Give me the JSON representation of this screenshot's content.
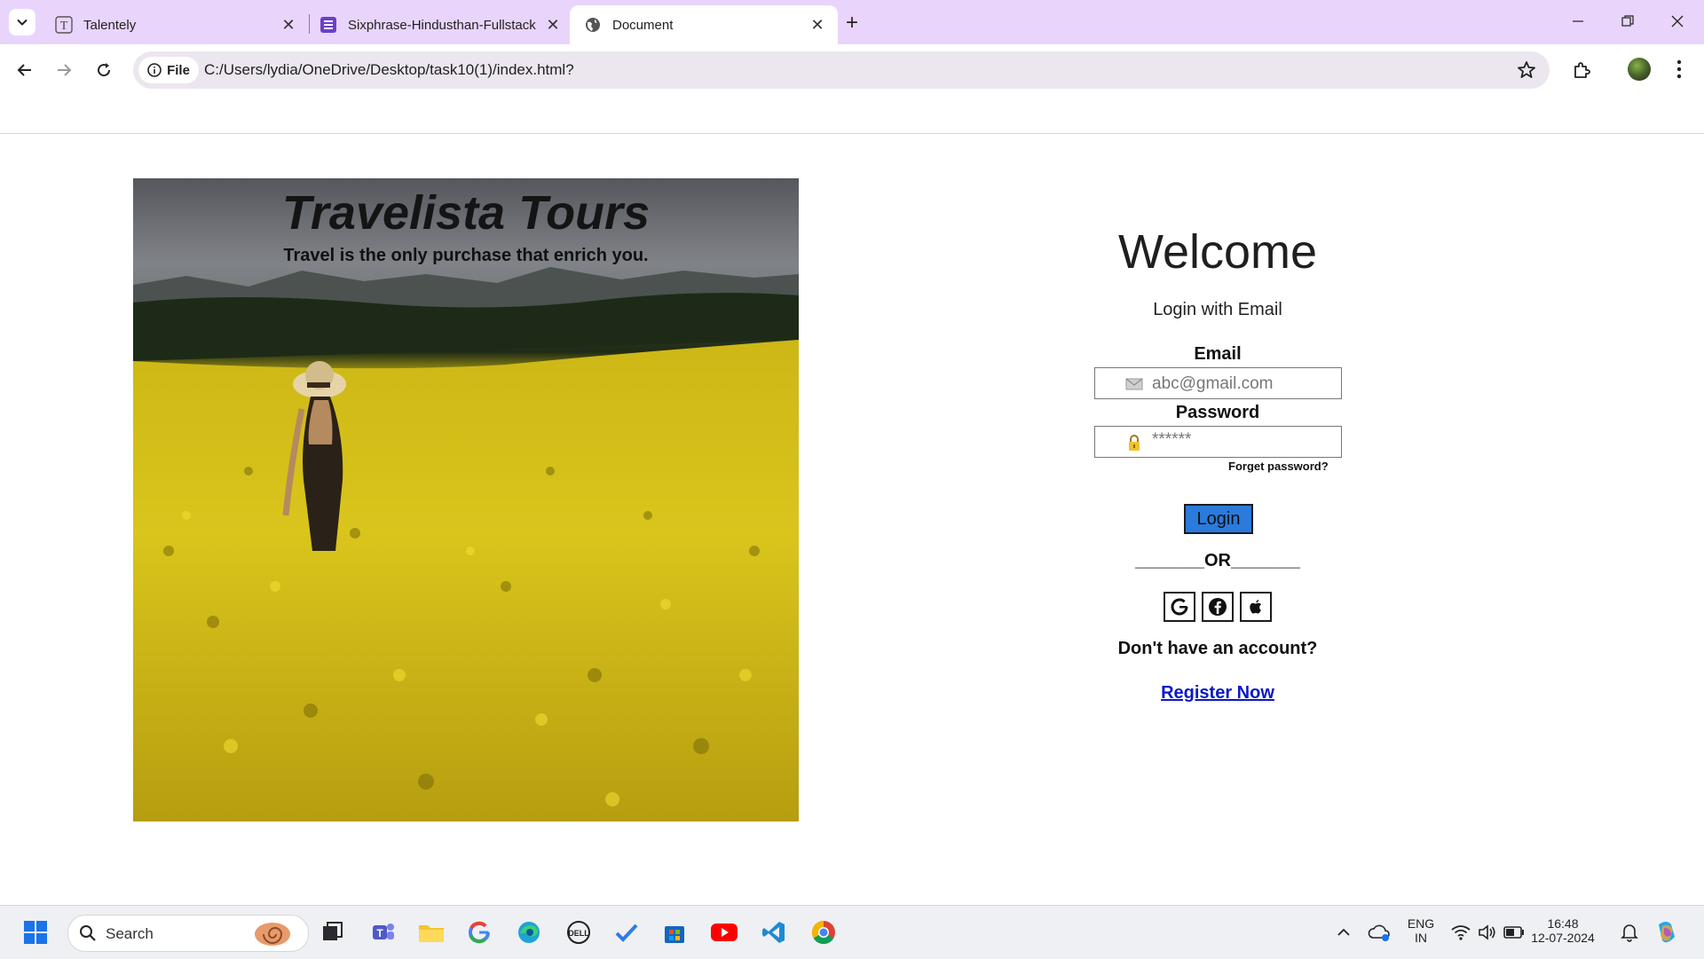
{
  "browser": {
    "tabs": [
      {
        "title": "Talentely",
        "icon": "talentely-t-icon"
      },
      {
        "title": "Sixphrase-Hindusthan-Fullstack",
        "icon": "document-list-icon"
      },
      {
        "title": "Document",
        "icon": "globe-icon"
      }
    ],
    "active_tab_index": 2,
    "address": {
      "chip_label": "File",
      "url": "C:/Users/lydia/OneDrive/Desktop/task10(1)/index.html?"
    },
    "colors": {
      "tabbar": "#e9d5fb",
      "omnibox": "#ece6ef"
    }
  },
  "hero": {
    "title": "Travelista Tours",
    "subtitle": "Travel is the only purchase that enrich you."
  },
  "login": {
    "heading": "Welcome",
    "subheading": "Login with Email",
    "email_label": "Email",
    "email_placeholder": "abc@gmail.com",
    "password_label": "Password",
    "password_placeholder": "******",
    "forgot": "Forget password?",
    "login_button": "Login",
    "divider": "_______OR_______",
    "social": [
      "google-icon",
      "facebook-icon",
      "apple-icon"
    ],
    "no_account": "Don't have an account?",
    "register": "Register Now",
    "colors": {
      "button": "#2a7bdc",
      "link": "#0a18c8"
    }
  },
  "taskbar": {
    "search_label": "Search",
    "language": "ENG",
    "region": "IN",
    "time": "16:48",
    "date": "12-07-2024"
  }
}
